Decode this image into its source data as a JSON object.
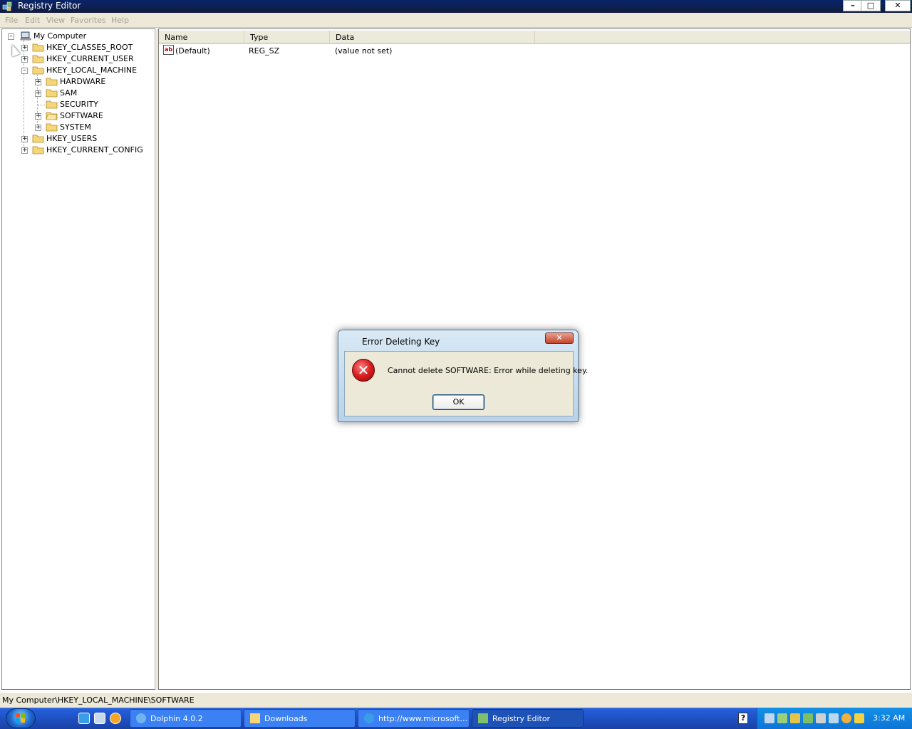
{
  "window": {
    "title": "Registry Editor",
    "controls": {
      "minimize": "–",
      "restore": "□",
      "close": "✕"
    }
  },
  "menu": [
    "File",
    "Edit",
    "View",
    "Favorites",
    "Help"
  ],
  "tree": {
    "root": "My Computer",
    "items": [
      {
        "label": "HKEY_CLASSES_ROOT",
        "expander": "+"
      },
      {
        "label": "HKEY_CURRENT_USER",
        "expander": "+"
      },
      {
        "label": "HKEY_LOCAL_MACHINE",
        "expander": "–"
      },
      {
        "label": "HARDWARE",
        "expander": "+"
      },
      {
        "label": "SAM",
        "expander": "+"
      },
      {
        "label": "SECURITY",
        "expander": ""
      },
      {
        "label": "SOFTWARE",
        "expander": "+"
      },
      {
        "label": "SYSTEM",
        "expander": "+"
      },
      {
        "label": "HKEY_USERS",
        "expander": "+"
      },
      {
        "label": "HKEY_CURRENT_CONFIG",
        "expander": "+"
      }
    ],
    "root_expander": "–"
  },
  "list": {
    "columns": [
      "Name",
      "Type",
      "Data"
    ],
    "rows": [
      {
        "icon": "ab",
        "name": "(Default)",
        "type": "REG_SZ",
        "data": "(value not set)"
      }
    ]
  },
  "status": "My Computer\\HKEY_LOCAL_MACHINE\\SOFTWARE",
  "dialog": {
    "title": "Error Deleting Key",
    "message": "Cannot delete SOFTWARE:  Error while deleting key.",
    "ok": "OK",
    "close": "✕",
    "error_glyph": "✕"
  },
  "taskbar": {
    "tasks": [
      {
        "label": "Dolphin 4.0.2",
        "icon": "dolphin-icon"
      },
      {
        "label": "Downloads",
        "icon": "folder-icon"
      },
      {
        "label": "http://www.microsoft...",
        "icon": "ie-icon"
      },
      {
        "label": "Registry Editor",
        "icon": "regedit-icon"
      }
    ],
    "help_glyph": "?",
    "clock": "3:32 AM"
  }
}
